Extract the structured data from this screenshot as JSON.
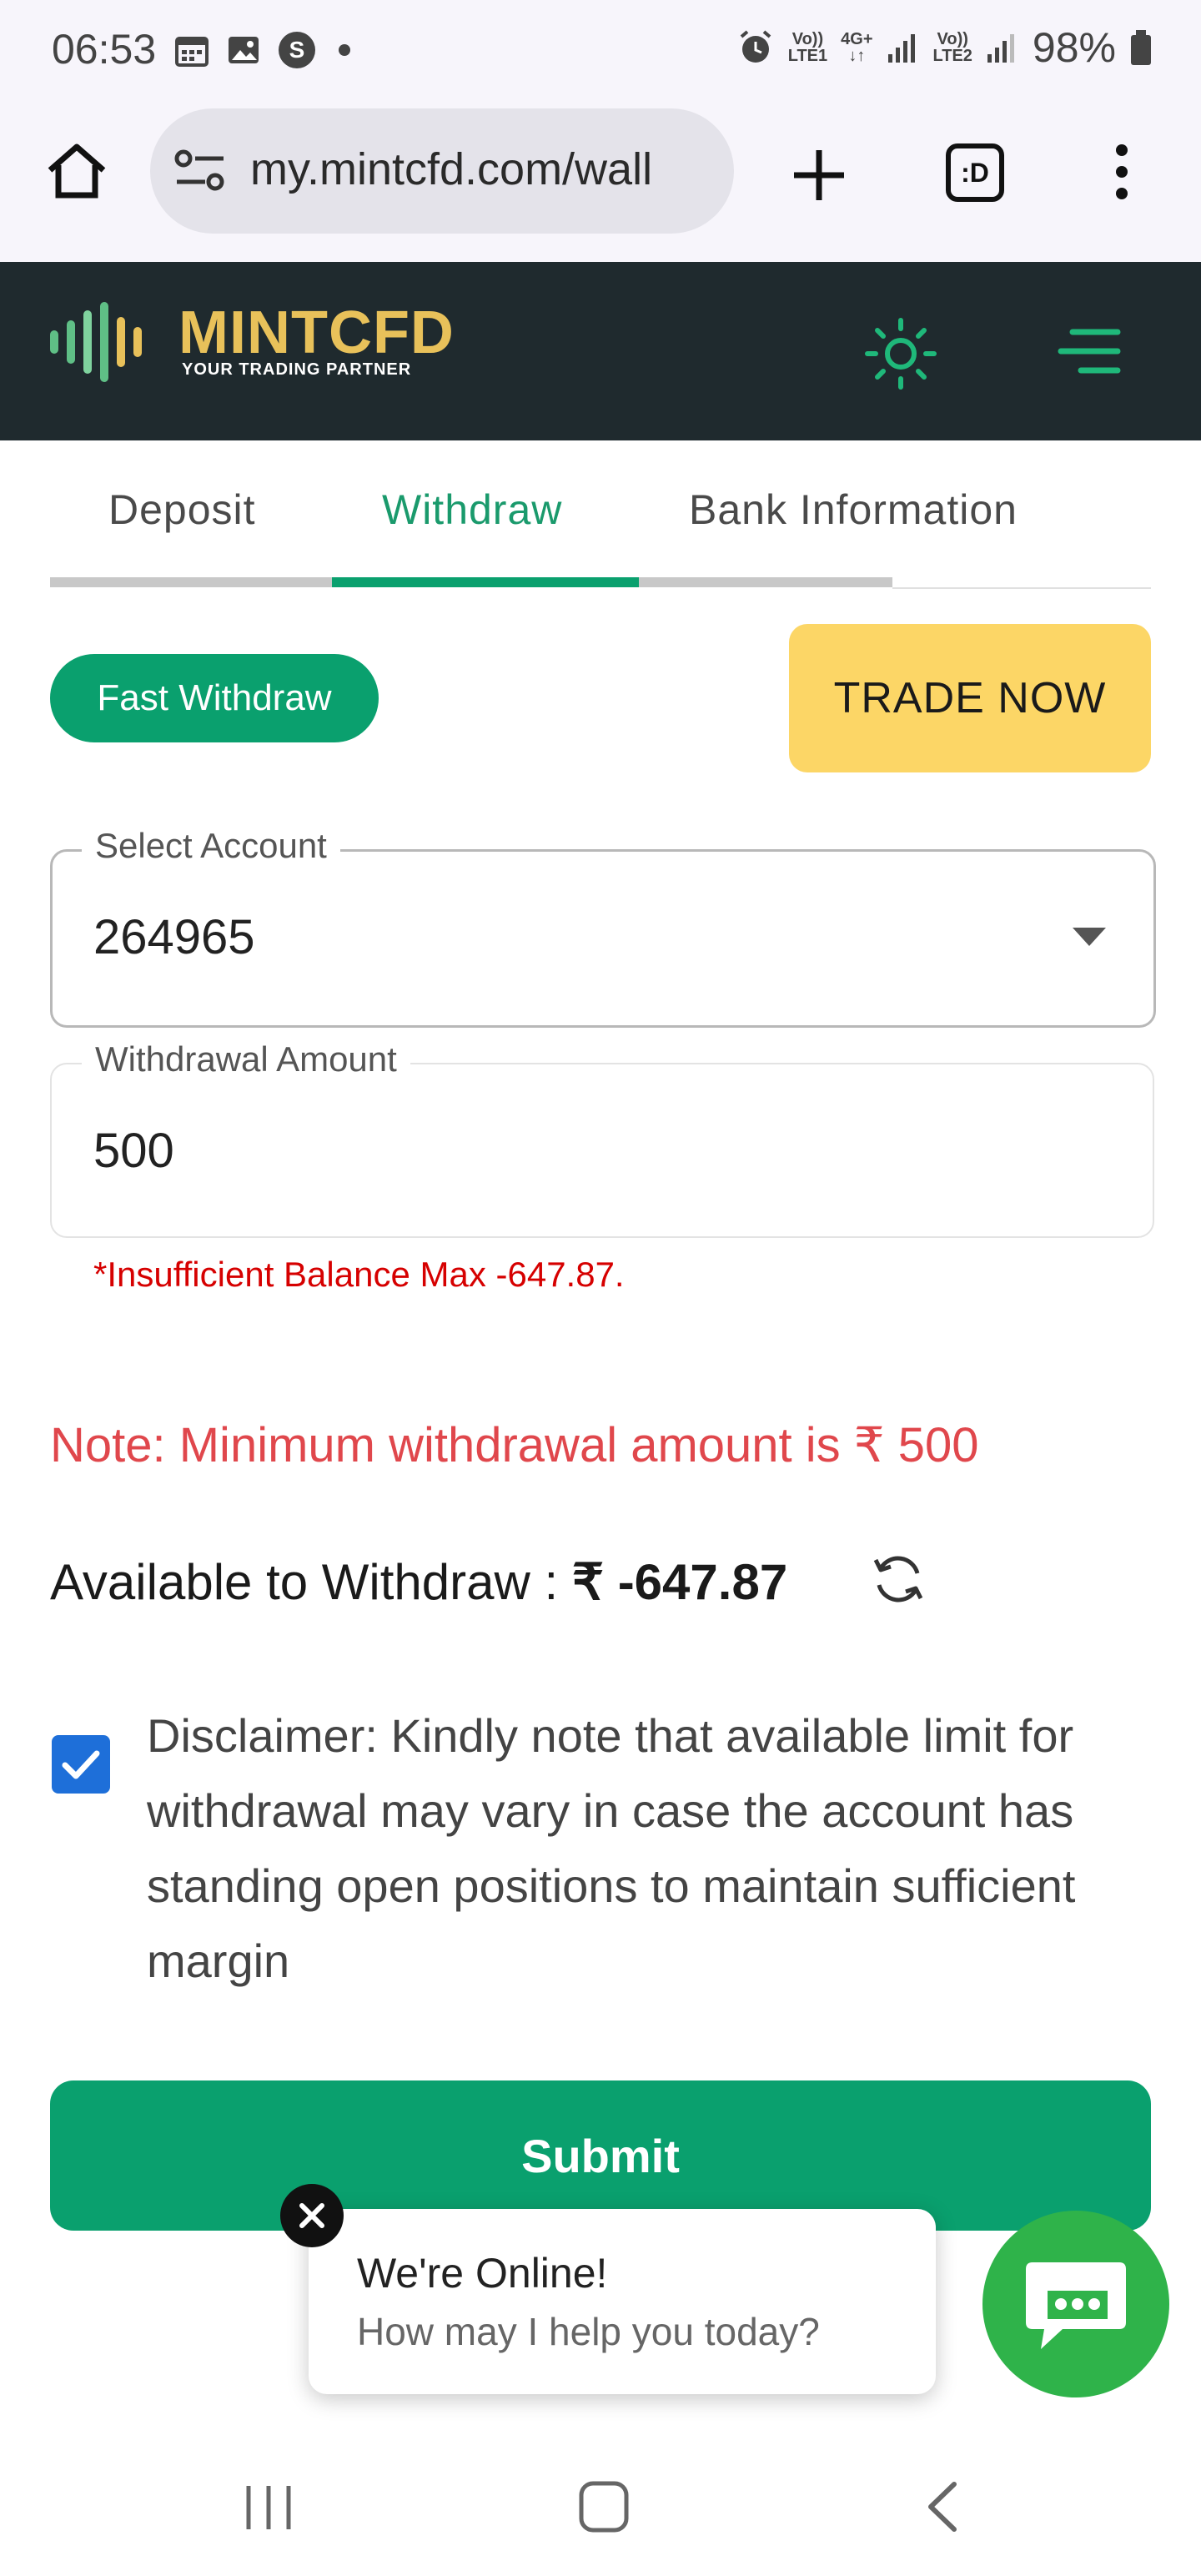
{
  "status_bar": {
    "time": "06:53",
    "net1_top": "Vo))",
    "net1_bottom": "LTE1",
    "net2_top": "4G+",
    "net3_top": "Vo))",
    "net3_bottom": "LTE2",
    "battery": "98%"
  },
  "browser": {
    "url": "my.mintcfd.com/wall",
    "tab_switcher_label": ":D"
  },
  "header": {
    "logo_text": "MINTCFD",
    "logo_tagline": "YOUR TRADING PARTNER"
  },
  "tabs": [
    {
      "label": "Deposit"
    },
    {
      "label": "Withdraw"
    },
    {
      "label": "Bank Information"
    }
  ],
  "buttons": {
    "fast_withdraw": "Fast Withdraw",
    "trade_now": "TRADE NOW",
    "submit": "Submit"
  },
  "form": {
    "select_account_label": "Select Account",
    "select_account_value": "264965",
    "amount_label": "Withdrawal Amount",
    "amount_value": "500",
    "error_text": "*Insufficient Balance Max -647.87."
  },
  "note_text": "Note: Minimum withdrawal amount is ₹ 500",
  "available": {
    "label": "Available to Withdraw : ",
    "value": "₹ -647.87"
  },
  "disclaimer": {
    "checked": true,
    "text": "Disclaimer: Kindly note that available limit for withdrawal may vary in case the account has standing open positions to maintain sufficient margin"
  },
  "chat": {
    "title": "We're Online!",
    "subtitle": "How may I help you today?"
  },
  "colors": {
    "accent_green": "#0aa06e",
    "header_dark": "#1f2a2e",
    "trade_yellow": "#fcd666",
    "error_red": "#d60000",
    "note_red": "#e0474c",
    "chat_green": "#2fb34a"
  }
}
